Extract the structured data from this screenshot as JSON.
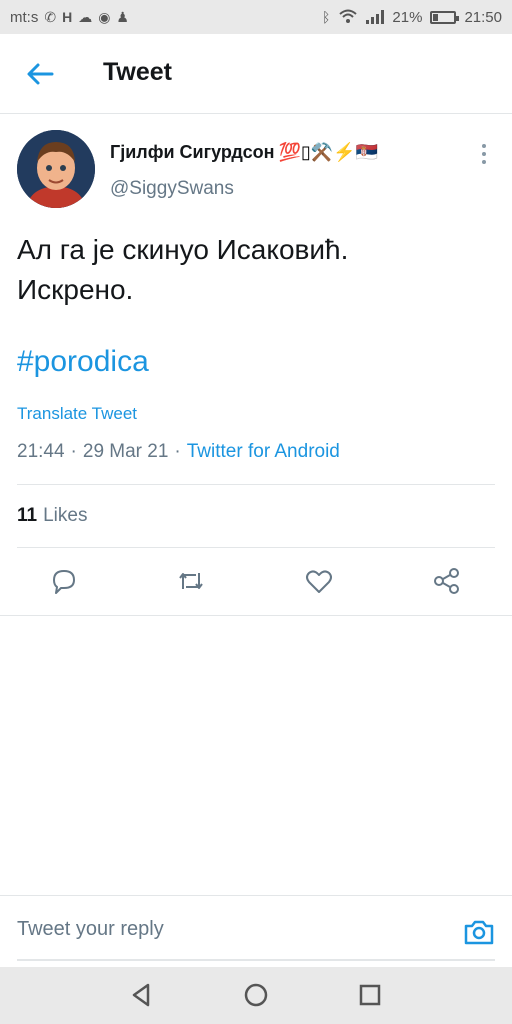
{
  "status_bar": {
    "left_text": "mt:s",
    "battery_percent": "21%",
    "battery_level": 0.21,
    "time": "21:50"
  },
  "app_bar": {
    "title": "Tweet",
    "back_icon": "arrow-left-icon"
  },
  "tweet": {
    "display_name": "Гјилфи Сигурдсон",
    "name_emojis": "💯▯⚒️⚡🇷🇸",
    "handle": "@SiggySwans",
    "text_line1": "Ал га је скинуо Исаковић.",
    "text_line2": "Искрено.",
    "hashtag": "#porodica",
    "translate_label": "Translate Tweet",
    "time": "21:44",
    "date": "29 Mar 21",
    "source": "Twitter for Android",
    "likes_count": "11",
    "likes_label": "Likes"
  },
  "actions": [
    "reply-icon",
    "retweet-icon",
    "like-icon",
    "share-icon"
  ],
  "reply": {
    "placeholder": "Tweet your reply",
    "camera_icon": "camera-icon"
  },
  "nav": [
    "back-triangle-icon",
    "home-circle-icon",
    "recents-square-icon"
  ],
  "colors": {
    "accent": "#1b95e0",
    "text": "#14171a",
    "muted": "#657786",
    "divider": "#e3e6e8"
  }
}
